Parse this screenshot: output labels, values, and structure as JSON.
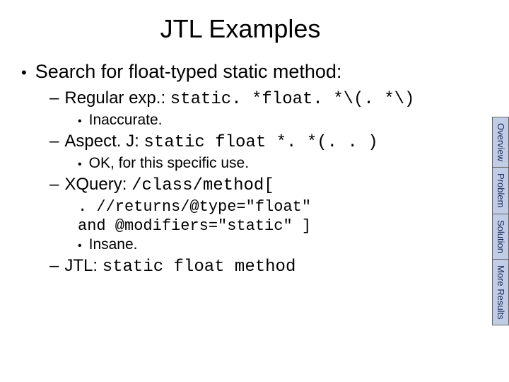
{
  "title": "JTL Examples",
  "main_bullet": "Search for float-typed static method:",
  "items": {
    "regex": {
      "label_prefix": "Regular exp.: ",
      "code": "static. *float. *\\(. *\\)",
      "note": "Inaccurate."
    },
    "aspectj": {
      "label_prefix": "Aspect. J: ",
      "code": "static float *. *(. . )",
      "note": "OK, for this specific use."
    },
    "xquery": {
      "label_prefix": "XQuery: ",
      "code": "/class/method[",
      "code_line1": ". //returns/@type=\"float\"",
      "code_line2": "and @modifiers=\"static\" ]",
      "note": "Insane."
    },
    "jtl": {
      "label_prefix": "JTL: ",
      "code": "static float method"
    }
  },
  "tabs": {
    "overview": "Overview",
    "problem": "Problem",
    "solution": "Solution",
    "more": "More Results"
  }
}
